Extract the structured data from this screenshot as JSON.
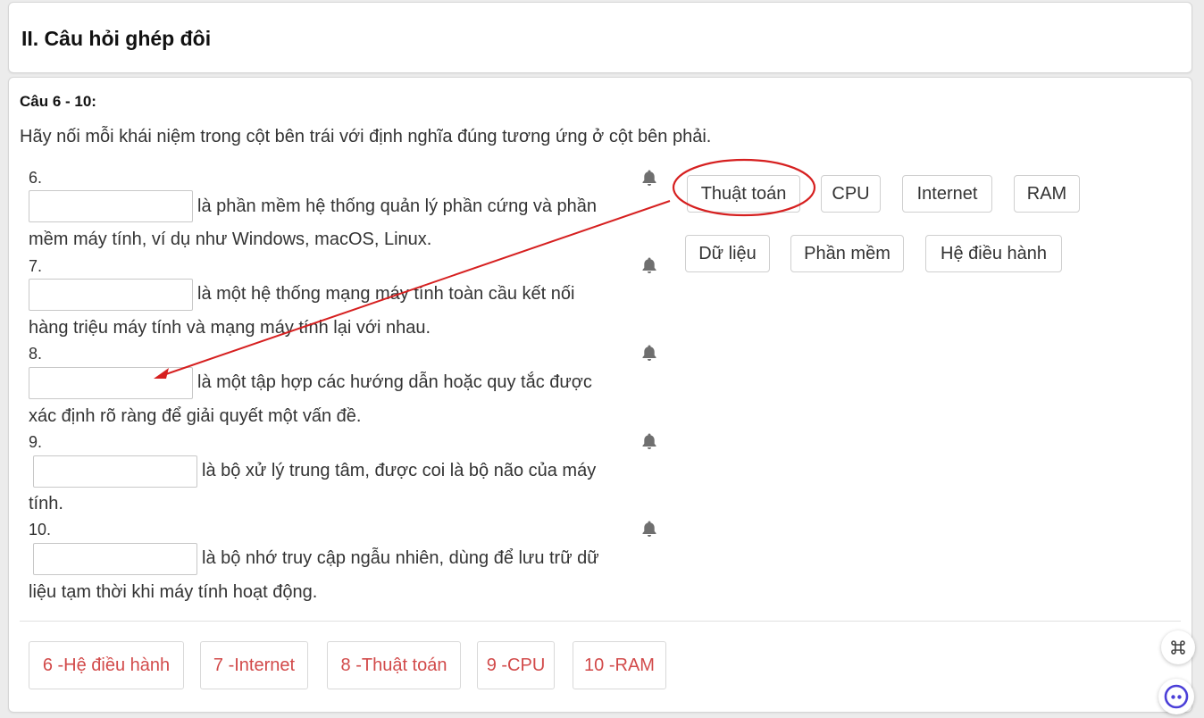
{
  "section": {
    "title": "II. Câu hỏi ghép đôi"
  },
  "question": {
    "range": "Câu 6 - 10:",
    "instruction": "Hãy nối mỗi khái niệm trong cột bên trái với định nghĩa đúng tương ứng ở cột bên phải.",
    "items": [
      {
        "number": "6.",
        "value": "",
        "line1": "là phần mềm hệ thống quản lý phần cứng và phần",
        "line2": "mềm máy tính, ví dụ như Windows, macOS, Linux."
      },
      {
        "number": "7.",
        "value": "",
        "line1": "là một hệ thống mạng máy tính toàn cầu kết nối",
        "line2": "hàng triệu máy tính và mạng máy tính lại với nhau."
      },
      {
        "number": "8.",
        "value": "",
        "line1": "là một tập hợp các hướng dẫn hoặc quy tắc được",
        "line2": "xác định rõ ràng để giải quyết một vấn đề."
      },
      {
        "number": "9.",
        "value": "",
        "line1": "là bộ xử lý trung tâm, được coi là bộ não của máy",
        "line2": "tính."
      },
      {
        "number": "10.",
        "value": "",
        "line1": "là bộ nhớ truy cập ngẫu nhiên, dùng để lưu trữ dữ",
        "line2": "liệu tạm thời khi máy tính hoạt động."
      }
    ],
    "options": [
      "Thuật toán",
      "CPU",
      "Internet",
      "RAM",
      "Dữ liệu",
      "Phần mềm",
      "Hệ điều hành"
    ],
    "answers": [
      "6 -Hệ điều hành",
      "7 -Internet",
      "8 -Thuật toán",
      "9 -CPU",
      "10 -RAM"
    ]
  },
  "icons": {
    "bell": "bell-icon",
    "command": "command-icon",
    "assistant": "assistant-icon"
  },
  "colors": {
    "answer_text": "#d24a4a",
    "annotation": "#d62020"
  }
}
